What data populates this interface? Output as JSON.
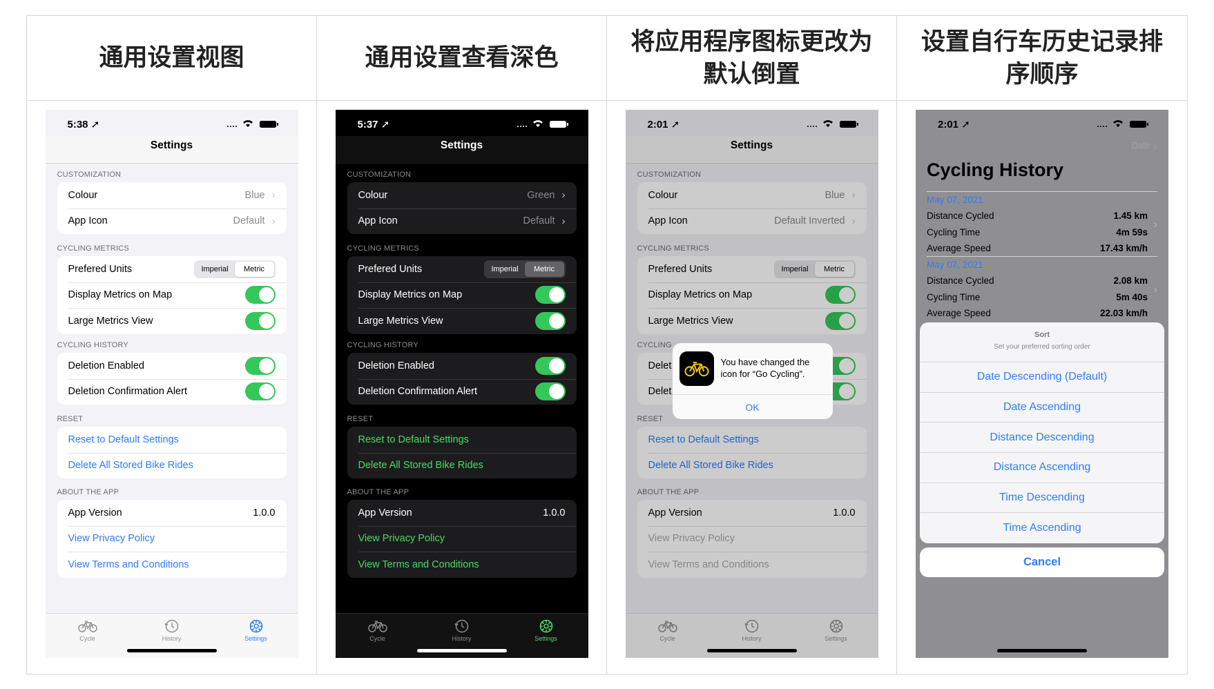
{
  "headers": [
    "通用设置视图",
    "通用设置查看深色",
    "将应用程序图标更改为默认倒置",
    "设置自行车历史记录排序顺序"
  ],
  "colors": {
    "accent_blue": "#2f7cf6",
    "accent_green": "#4cd964",
    "toggle_on": "#34c759"
  },
  "phones": [
    {
      "time": "5:38",
      "nav_title": "Settings",
      "sections": {
        "customization": "CUSTOMIZATION",
        "metrics": "CYCLING METRICS",
        "history": "CYCLING HISTORY",
        "reset": "RESET",
        "about": "ABOUT THE APP"
      },
      "colour_label": "Colour",
      "colour_value": "Blue",
      "icon_label": "App Icon",
      "icon_value": "Default",
      "units_label": "Prefered Units",
      "seg_imperial": "Imperial",
      "seg_metric": "Metric",
      "display_map": "Display Metrics on Map",
      "large_view": "Large Metrics View",
      "deletion": "Deletion Enabled",
      "deletion_alert": "Deletion Confirmation Alert",
      "reset_defaults": "Reset to Default Settings",
      "delete_all": "Delete All Stored Bike Rides",
      "app_version_label": "App Version",
      "app_version": "1.0.0",
      "privacy": "View Privacy Policy",
      "terms": "View Terms and Conditions",
      "tabs": [
        "Cycle",
        "History",
        "Settings"
      ]
    },
    {
      "time": "5:37",
      "nav_title": "Settings",
      "sections": {
        "customization": "CUSTOMIZATION",
        "metrics": "CYCLING METRICS",
        "history": "CYCLING HISTORY",
        "reset": "RESET",
        "about": "ABOUT THE APP"
      },
      "colour_label": "Colour",
      "colour_value": "Green",
      "icon_label": "App Icon",
      "icon_value": "Default",
      "units_label": "Prefered Units",
      "seg_imperial": "Imperial",
      "seg_metric": "Metric",
      "display_map": "Display Metrics on Map",
      "large_view": "Large Metrics View",
      "deletion": "Deletion Enabled",
      "deletion_alert": "Deletion Confirmation Alert",
      "reset_defaults": "Reset to Default Settings",
      "delete_all": "Delete All Stored Bike Rides",
      "app_version_label": "App Version",
      "app_version": "1.0.0",
      "privacy": "View Privacy Policy",
      "terms": "View Terms and Conditions",
      "tabs": [
        "Cycle",
        "History",
        "Settings"
      ]
    },
    {
      "time": "2:01",
      "nav_title": "Settings",
      "sections": {
        "customization": "CUSTOMIZATION",
        "metrics": "CYCLING METRICS",
        "history": "CYCLING",
        "reset": "RESET",
        "about": "ABOUT THE APP"
      },
      "colour_label": "Colour",
      "colour_value": "Blue",
      "icon_label": "App Icon",
      "icon_value": "Default Inverted",
      "units_label": "Prefered Units",
      "seg_imperial": "Imperial",
      "seg_metric": "Metric",
      "display_map": "Display Metrics on Map",
      "large_view": "Large Metrics View",
      "deletion": "Delet",
      "deletion_alert": "Delet",
      "reset_defaults": "Reset to Default Settings",
      "delete_all": "Delete All Stored Bike Rides",
      "app_version_label": "App Version",
      "app_version": "1.0.0",
      "privacy": "View Privacy Policy",
      "terms": "View Terms and Conditions",
      "tabs": [
        "Cycle",
        "History",
        "Settings"
      ],
      "alert": {
        "message": "You have changed the icon for “Go Cycling”.",
        "ok": "OK"
      }
    },
    {
      "time": "2:01",
      "sort_button": "Date ↓",
      "title": "Cycling History",
      "rides": [
        {
          "date": "May 07, 2021",
          "rows": [
            [
              "Distance Cycled",
              "1.45 km"
            ],
            [
              "Cycling Time",
              "4m 59s"
            ],
            [
              "Average Speed",
              "17.43 km/h"
            ]
          ]
        },
        {
          "date": "May 07, 2021",
          "rows": [
            [
              "Distance Cycled",
              "2.08 km"
            ],
            [
              "Cycling Time",
              "5m 40s"
            ],
            [
              "Average Speed",
              "22.03 km/h"
            ]
          ]
        }
      ],
      "sheet_title": "Sort",
      "sheet_subtitle": "Set your preferred sorting order",
      "options": [
        "Date Descending (Default)",
        "Date Ascending",
        "Distance Descending",
        "Distance Ascending",
        "Time Descending",
        "Time Ascending"
      ],
      "cancel": "Cancel"
    }
  ]
}
